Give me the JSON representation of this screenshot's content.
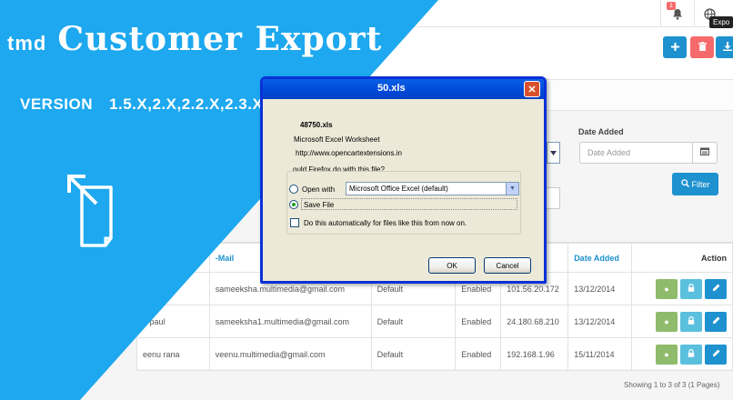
{
  "promo": {
    "brand": "tmd",
    "product": "Customer Export",
    "version_label": "VERSION",
    "version_value": "1.5.X,2.X,2.2.X,2.3.X,3.X"
  },
  "topbar": {
    "notification_count": "1"
  },
  "header": {
    "tooltip": "Expo"
  },
  "filter": {
    "date_added_label": "Date Added",
    "date_added_placeholder": "Date Added",
    "filter_button": "Filter"
  },
  "dialog": {
    "title": "50.xls",
    "filename": "48750.xls",
    "type_line": "Microsoft Excel Worksheet",
    "from_line": "http://www.opencartextensions.in",
    "question": "ould Firefox do with this file?",
    "open_with_label": "Open with",
    "open_with_value": "Microsoft Office Excel (default)",
    "save_file_label": "Save File",
    "auto_label": "Do this automatically for files like this from now on.",
    "ok_label": "OK",
    "cancel_label": "Cancel"
  },
  "table": {
    "headers": {
      "email": "-Mail",
      "date_added": "Date Added",
      "action": "Action"
    },
    "rows": [
      {
        "name": "",
        "email": "sameeksha.multimedia@gmail.com",
        "group": "Default",
        "status": "Enabled",
        "ip": "101.56.20.172",
        "date": "13/12/2014"
      },
      {
        "name": "a paul",
        "email": "sameeksha1.multimedia@gmail.com",
        "group": "Default",
        "status": "Enabled",
        "ip": "24.180.68.210",
        "date": "13/12/2014"
      },
      {
        "name": "eenu rana",
        "email": "veenu.multimedia@gmail.com",
        "group": "Default",
        "status": "Enabled",
        "ip": "192.168.1.96",
        "date": "15/11/2014"
      }
    ],
    "showing": "Showing 1 to 3 of 3 (1 Pages)"
  },
  "icons": {
    "bell": "bell-icon",
    "globe": "globe-icon",
    "plus": "plus-icon",
    "trash": "trash-icon",
    "download": "download-icon",
    "calendar": "calendar-icon",
    "search": "search-icon",
    "edit": "pencil-icon",
    "lock": "lock-icon",
    "login": "thumb-icon",
    "export_arrow": "export-arrow-icon"
  },
  "colors": {
    "promo_blue": "#1da8ef",
    "admin_blue": "#1e91cf",
    "danger_red": "#f56b6b",
    "success_green": "#8fbb6c",
    "info_blue": "#5bc0de",
    "xp_title_blue": "#0048d6"
  }
}
